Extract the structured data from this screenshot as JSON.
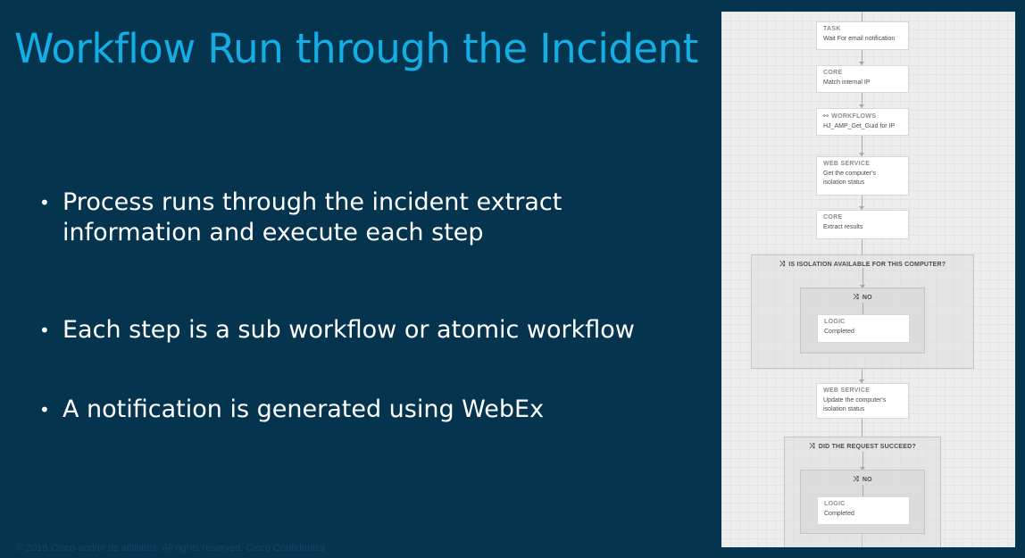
{
  "slide": {
    "title": "Workflow Run through the Incident",
    "bullets": [
      "Process runs through the incident extract information and execute each step",
      "Each step is a sub workflow or atomic workflow",
      "A notification is generated using WebEx"
    ],
    "bullet_marker": "•",
    "footer": "© 2018  Cisco and/or its affiliates. All rights reserved.   Cisco Confidential"
  },
  "workflow": {
    "nodes": [
      {
        "type": "TASK",
        "name": "Wait For email notification"
      },
      {
        "type": "CORE",
        "name": "Match internal IP"
      },
      {
        "type": "WORKFLOWS",
        "name": "HJ_AMP_Get_Guid for IP",
        "icon": "workflow-icon"
      },
      {
        "type": "WEB SERVICE",
        "name": "Get the computer's isolation status"
      },
      {
        "type": "CORE",
        "name": "Extract results"
      },
      {
        "type": "WEB SERVICE",
        "name": "Update the computer's isolation status"
      }
    ],
    "conditions": [
      {
        "label": "IS ISOLATION AVAILABLE FOR THIS COMPUTER?",
        "branch": "NO",
        "node": {
          "type": "LOGIC",
          "name": "Completed"
        }
      },
      {
        "label": "DID THE REQUEST SUCCEED?",
        "branch": "NO",
        "node": {
          "type": "LOGIC",
          "name": "Completed"
        }
      }
    ],
    "condition_icon": "shuffle-icon"
  }
}
